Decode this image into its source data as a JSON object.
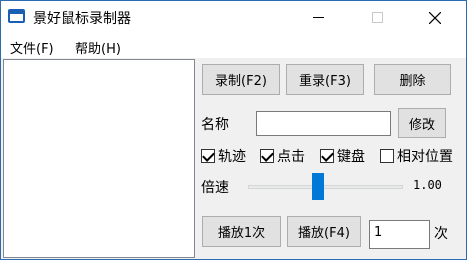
{
  "window": {
    "title": "景好鼠标录制器",
    "minimize_glyph": "—",
    "close_glyph": "✕"
  },
  "menu": {
    "file": "文件(F)",
    "help": "帮助(H)"
  },
  "buttons": {
    "record": "录制(F2)",
    "rerecord": "重录(F3)",
    "delete": "删除",
    "modify": "修改",
    "play_once": "播放1次",
    "play": "播放(F4)"
  },
  "name": {
    "label": "名称",
    "value": ""
  },
  "options": [
    {
      "label": "轨迹",
      "checked": true
    },
    {
      "label": "点击",
      "checked": true
    },
    {
      "label": "键盘",
      "checked": true
    },
    {
      "label": "相对位置",
      "checked": false
    }
  ],
  "speed": {
    "label": "倍速",
    "value_text": "1.00",
    "slider_fraction": 0.45
  },
  "repeat": {
    "count": "1",
    "unit": "次"
  }
}
